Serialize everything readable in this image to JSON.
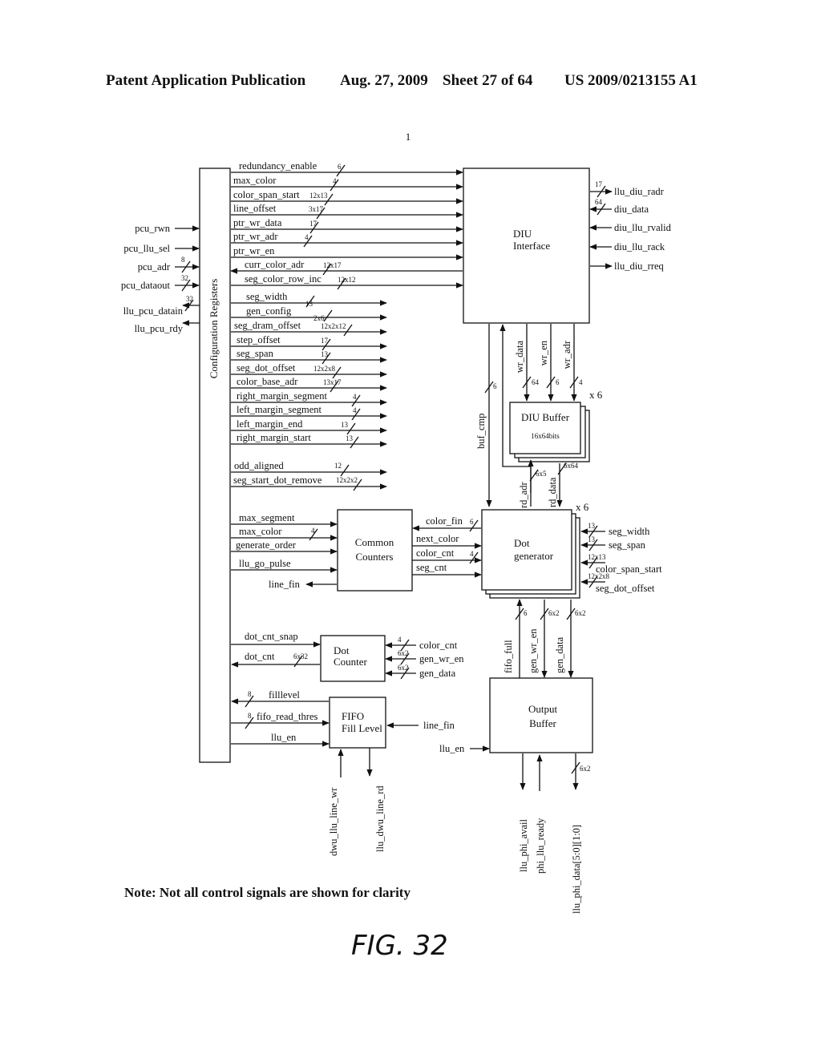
{
  "header": {
    "left": "Patent Application Publication",
    "date": "Aug. 27, 2009",
    "sheet": "Sheet 27 of 64",
    "pub_number": "US 2009/0213155 A1"
  },
  "ref_mark": "1",
  "blocks": {
    "config_registers": "Configuration Registers",
    "diu_interface": [
      "DIU",
      "Interface"
    ],
    "diu_buffer": [
      "DIU Buffer",
      "16x64bits"
    ],
    "diu_buffer_mult": "x 6",
    "common_counters": [
      "Common",
      "Counters"
    ],
    "dot_generator": [
      "Dot",
      "generator"
    ],
    "dot_generator_mult": "x 6",
    "dot_counter": [
      "Dot",
      "Counter"
    ],
    "fifo_fill_level": [
      "FIFO",
      "Fill Level"
    ],
    "output_buffer": [
      "Output",
      "Buffer"
    ]
  },
  "pcu_signals": [
    {
      "name": "pcu_rwn",
      "width": "",
      "dir": "in"
    },
    {
      "name": "pcu_llu_sel",
      "width": "",
      "dir": "in"
    },
    {
      "name": "pcu_adr",
      "width": "8",
      "dir": "in"
    },
    {
      "name": "pcu_dataout",
      "width": "32",
      "dir": "in"
    },
    {
      "name": "llu_pcu_datain",
      "width": "32",
      "dir": "out"
    },
    {
      "name": "llu_pcu_rdy",
      "width": "",
      "dir": "out"
    }
  ],
  "diu_bus": [
    {
      "name": "redundancy_enable",
      "width": "6",
      "dir": "right"
    },
    {
      "name": "max_color",
      "width": "4",
      "dir": "right"
    },
    {
      "name": "color_span_start",
      "width": "12x13",
      "dir": "right"
    },
    {
      "name": "line_offset",
      "width": "3x17",
      "dir": "right"
    },
    {
      "name": "ptr_wr_data",
      "width": "17",
      "dir": "right"
    },
    {
      "name": "ptr_wr_adr",
      "width": "4",
      "dir": "right"
    },
    {
      "name": "ptr_wr_en",
      "width": "",
      "dir": "right"
    },
    {
      "name": "curr_color_adr",
      "width": "12x17",
      "dir": "left"
    },
    {
      "name": "seg_color_row_inc",
      "width": "12x12",
      "dir": "right"
    }
  ],
  "config_out": [
    {
      "name": "seg_width",
      "width": "13"
    },
    {
      "name": "gen_config",
      "width": "2x6"
    },
    {
      "name": "seg_dram_offset",
      "width": "12x2x12"
    },
    {
      "name": "step_offset",
      "width": "17"
    },
    {
      "name": "seg_span",
      "width": "13"
    },
    {
      "name": "seg_dot_offset",
      "width": "12x2x8"
    },
    {
      "name": "color_base_adr",
      "width": "13x17"
    },
    {
      "name": "right_margin_segment",
      "width": "4"
    },
    {
      "name": "left_margin_segment",
      "width": "4"
    },
    {
      "name": "left_margin_end",
      "width": "13"
    },
    {
      "name": "right_margin_start",
      "width": "13"
    }
  ],
  "config_out2": [
    {
      "name": "odd_aligned",
      "width": "12"
    },
    {
      "name": "seg_start_dot_remove",
      "width": "12x2x2"
    }
  ],
  "diu_external": [
    {
      "name": "llu_diu_radr",
      "width": "17",
      "dir": "out"
    },
    {
      "name": "diu_data",
      "width": "64",
      "dir": "in"
    },
    {
      "name": "diu_llu_rvalid",
      "width": "",
      "dir": "in"
    },
    {
      "name": "diu_llu_rack",
      "width": "",
      "dir": "in"
    },
    {
      "name": "llu_diu_rreq",
      "width": "",
      "dir": "out"
    }
  ],
  "diu_to_buffer": [
    {
      "name": "wr_data",
      "width": "64"
    },
    {
      "name": "wr_en",
      "width": "6"
    },
    {
      "name": "wr_adr",
      "width": "4"
    }
  ],
  "buf_cmp": {
    "name": "buf_cmp",
    "width": "6"
  },
  "rd_adr": {
    "name": "rd_adr",
    "width": "6x5"
  },
  "rd_data": {
    "name": "rd_data",
    "width": "6x64"
  },
  "common_inputs": [
    {
      "name": "max_segment",
      "width": ""
    },
    {
      "name": "max_color",
      "width": "4"
    },
    {
      "name": "generate_order",
      "width": ""
    },
    {
      "name": "llu_go_pulse",
      "width": ""
    }
  ],
  "common_output": {
    "name": "line_fin"
  },
  "common_dotgen": [
    {
      "name": "color_fin",
      "width": "6",
      "dir": "left"
    },
    {
      "name": "next_color",
      "width": "",
      "dir": "right"
    },
    {
      "name": "color_cnt",
      "width": "4",
      "dir": "right"
    },
    {
      "name": "seg_cnt",
      "width": "",
      "dir": "right"
    }
  ],
  "dotgen_inputs": [
    {
      "name": "seg_width",
      "width": "13"
    },
    {
      "name": "seg_span",
      "width": "13"
    },
    {
      "name": "color_span_start",
      "width": "12x13"
    },
    {
      "name": "seg_dot_offset",
      "width": "12x2x8"
    }
  ],
  "dotgen_to_output": [
    {
      "name": "fifo_full",
      "width": "6",
      "dir": "up"
    },
    {
      "name": "gen_wr_en",
      "width": "6x2",
      "dir": "down"
    },
    {
      "name": "gen_data",
      "width": "6x2",
      "dir": "down"
    }
  ],
  "dot_counter_left": [
    {
      "name": "dot_cnt_snap",
      "width": "",
      "dir": "right"
    },
    {
      "name": "dot_cnt",
      "width": "6x32",
      "dir": "left"
    }
  ],
  "dot_counter_right": [
    {
      "name": "color_cnt",
      "width": "4"
    },
    {
      "name": "gen_wr_en",
      "width": "6x2"
    },
    {
      "name": "gen_data",
      "width": "6x2"
    }
  ],
  "fifo_left": [
    {
      "name": "filllevel",
      "width": "8",
      "dir": "left"
    },
    {
      "name": "fifo_read_thres",
      "width": "8",
      "dir": "right"
    },
    {
      "name": "llu_en",
      "width": "",
      "dir": "right"
    }
  ],
  "fifo_right": {
    "name": "line_fin"
  },
  "fifo_bottom": [
    {
      "name": "dwu_llu_line_wr",
      "dir": "up"
    },
    {
      "name": "llu_dwu_line_rd",
      "dir": "down"
    }
  ],
  "output_left": {
    "name": "llu_en"
  },
  "output_bottom": [
    {
      "name": "llu_phi_avail",
      "width": "",
      "dir": "down"
    },
    {
      "name": "phi_llu_ready",
      "width": "",
      "dir": "up"
    },
    {
      "name": "llu_phi_data[5:0][1:0]",
      "width": "6x2",
      "dir": "down"
    }
  ],
  "note": "Note: Not all control signals are shown for clarity",
  "figure_label": "FIG. 32"
}
